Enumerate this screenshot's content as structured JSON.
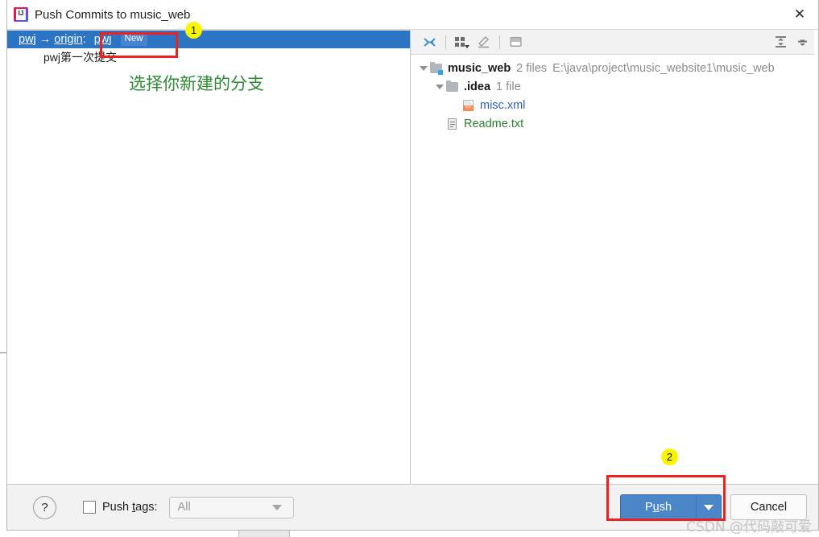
{
  "window": {
    "title": "Push Commits to music_web",
    "icon": "intellij-idea-logo",
    "close_label": "✕"
  },
  "left_pane": {
    "branch_row": {
      "source": "pwj",
      "arrow": "→",
      "remote": "origin",
      "separator": ":",
      "target": "pwj",
      "tag": "New"
    },
    "commits": [
      {
        "message": "pwj第一次提交"
      }
    ]
  },
  "right_pane": {
    "toolbar": {
      "items": [
        {
          "name": "expand-selection-icon",
          "label": ""
        },
        {
          "name": "group-by-icon",
          "label": ""
        },
        {
          "name": "edit-icon",
          "label": ""
        },
        {
          "name": "preview-diff-icon",
          "label": ""
        },
        {
          "name": "expand-all-icon",
          "label": ""
        },
        {
          "name": "collapse-all-icon",
          "label": ""
        }
      ]
    },
    "tree": [
      {
        "name": "music_web",
        "count": "2 files",
        "path": "E:\\java\\project\\music_website1\\music_web",
        "icon": "folder-vcs-icon",
        "expanded": true,
        "indent": 0,
        "color": "default"
      },
      {
        "name": ".idea",
        "count": "1 file",
        "path": "",
        "icon": "folder-icon",
        "expanded": true,
        "indent": 1,
        "color": "default"
      },
      {
        "name": "misc.xml",
        "count": "",
        "path": "",
        "icon": "xml-file-icon",
        "expanded": null,
        "indent": 2,
        "color": "blue"
      },
      {
        "name": "Readme.txt",
        "count": "",
        "path": "",
        "icon": "txt-file-icon",
        "expanded": null,
        "indent": 1,
        "color": "green"
      }
    ]
  },
  "bottom_bar": {
    "help_label": "?",
    "push_tags_checkbox_checked": false,
    "push_tags_label_before": "Push ",
    "push_tags_label_mnemonic": "t",
    "push_tags_label_after": "ags:",
    "tags_dropdown_value": "All",
    "push_button_label_before": "P",
    "push_button_label_mnemonic": "u",
    "push_button_label_after": "sh",
    "push_button_full": "Push",
    "cancel_button_label": "Cancel"
  },
  "annotations": {
    "badge_1": "1",
    "badge_2": "2",
    "green_note": "选择你新建的分支",
    "highlight_color": "#ef2020",
    "badge_color": "#fbf500",
    "note_color": "#2e8b33"
  },
  "watermark": {
    "text": "CSDN @代码敲可爱"
  }
}
